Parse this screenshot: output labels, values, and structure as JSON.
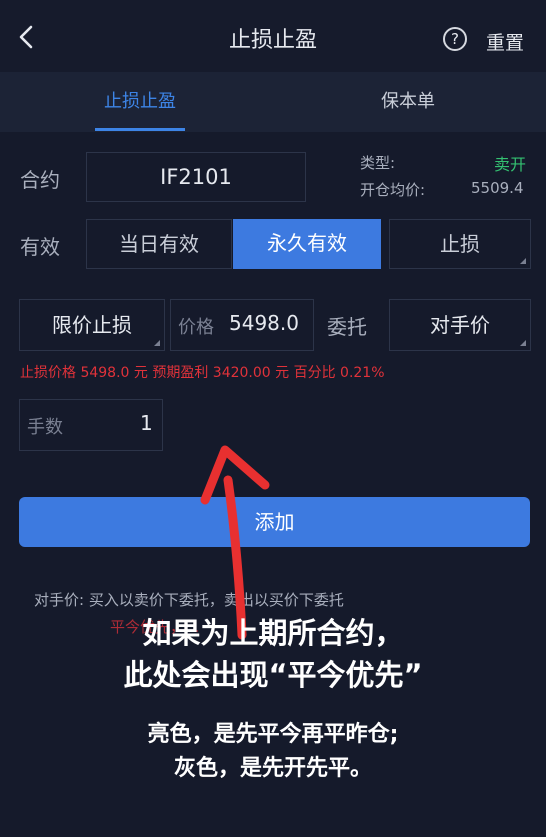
{
  "header": {
    "title": "止损止盈",
    "reset_label": "重置"
  },
  "tabs": [
    {
      "label": "止损止盈",
      "active": true
    },
    {
      "label": "保本单",
      "active": false
    }
  ],
  "contract": {
    "label": "合约",
    "value": "IF2101"
  },
  "order_info": {
    "type_label": "类型:",
    "type_value": "卖开",
    "avg_price_label": "开仓均价:",
    "avg_price_value": "5509.4"
  },
  "validity": {
    "label": "有效",
    "options": [
      "当日有效",
      "永久有效",
      "止损"
    ],
    "selected": "永久有效"
  },
  "order_row": {
    "order_type": "限价止损",
    "price_label": "价格",
    "price_value": "5498.0",
    "entrust_label": "委托",
    "entrust_value": "对手价"
  },
  "warning": "止损价格 5498.0 元  预期盈利 3420.00 元  百分比 0.21%",
  "quantity": {
    "label": "手数",
    "value": "1"
  },
  "add_button": "添加",
  "hint": "对手价:  买入以卖价下委托，卖出以买价下委托",
  "faded_hint": "平今优先，...",
  "overlay": {
    "line1": "如果为上期所合约，",
    "line2": "此处会出现“平今优先”",
    "line3": "亮色，是先平今再平昨仓;",
    "line4": "灰色，是先开先平。"
  },
  "colors": {
    "accent": "#3d7ae0",
    "sell": "#34c071",
    "warning": "#e0323a",
    "background": "#151a2b"
  }
}
